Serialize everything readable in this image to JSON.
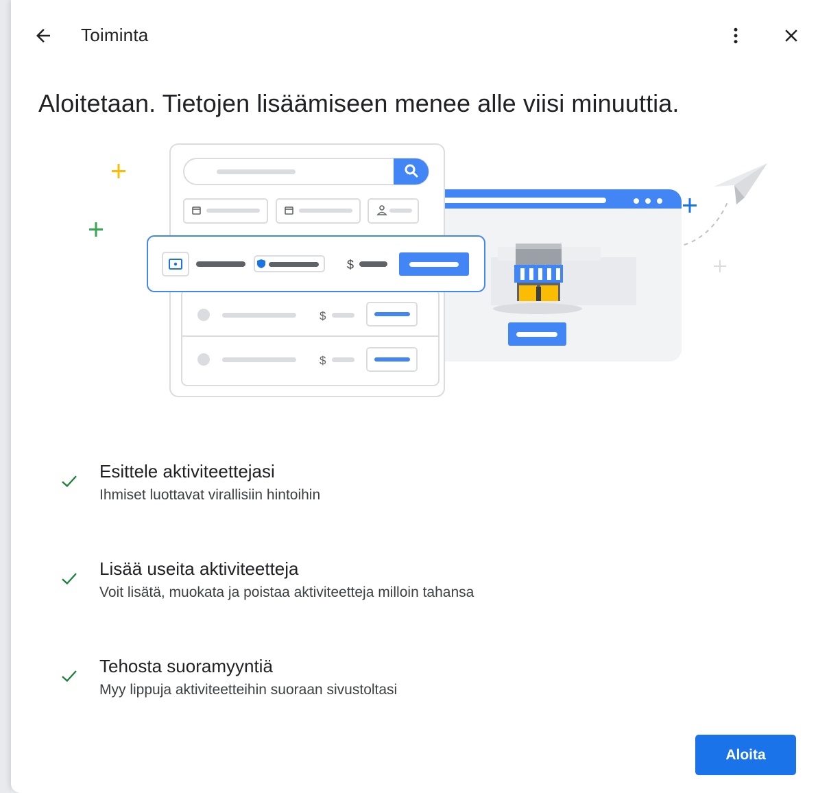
{
  "header": {
    "title": "Toiminta",
    "back_icon": "arrow-back-icon",
    "more_icon": "more-vert-icon",
    "close_icon": "close-icon"
  },
  "heading": "Aloitetaan. Tietojen lisäämiseen menee alle viisi minuuttia.",
  "illustration": {
    "currency_symbol": "$"
  },
  "features": [
    {
      "title": "Esittele aktiviteettejasi",
      "description": "Ihmiset luottavat virallisiin hintoihin"
    },
    {
      "title": "Lisää useita aktiviteetteja",
      "description": "Voit lisätä, muokata ja poistaa aktiviteetteja milloin tahansa"
    },
    {
      "title": "Tehosta suoramyyntiä",
      "description": "Myy lippuja aktiviteetteihin suoraan sivustoltasi"
    }
  ],
  "actions": {
    "start_label": "Aloita"
  },
  "colors": {
    "primary": "#1a73e8",
    "check": "#188038",
    "text": "#202124",
    "yellow_plus": "#fbbc04",
    "green_plus": "#34a853"
  }
}
